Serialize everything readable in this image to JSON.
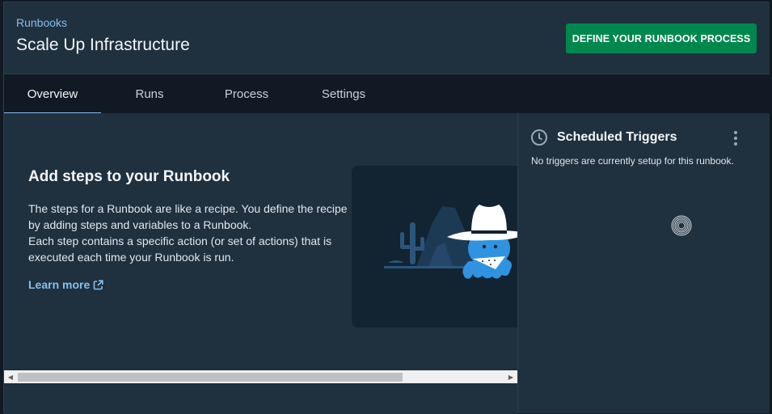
{
  "header": {
    "breadcrumb": "Runbooks",
    "title": "Scale Up Infrastructure",
    "define_button": "DEFINE YOUR RUNBOOK PROCESS"
  },
  "tabs": [
    {
      "label": "Overview",
      "active": true
    },
    {
      "label": "Runs",
      "active": false
    },
    {
      "label": "Process",
      "active": false
    },
    {
      "label": "Settings",
      "active": false
    }
  ],
  "onboarding": {
    "title": "Add steps to your Runbook",
    "paragraph1": "The steps for a Runbook are like a recipe. You define the recipe by adding steps and variables to a Runbook.",
    "paragraph2": "Each step contains a specific action (or set of actions) that is executed each time your Runbook is run.",
    "learn_more": "Learn more",
    "learn_more_icon": "external-link-icon",
    "illustration": "octopus-cowboy-desert"
  },
  "sidebar": {
    "title": "Scheduled Triggers",
    "title_icon": "clock-icon",
    "empty_text": "No triggers are currently setup for this runbook.",
    "menu_icon": "more-vertical-icon"
  },
  "colors": {
    "accent": "#87bfec",
    "primary_button": "#00874d",
    "background": "#1f303f",
    "tabbar": "#111a24"
  }
}
